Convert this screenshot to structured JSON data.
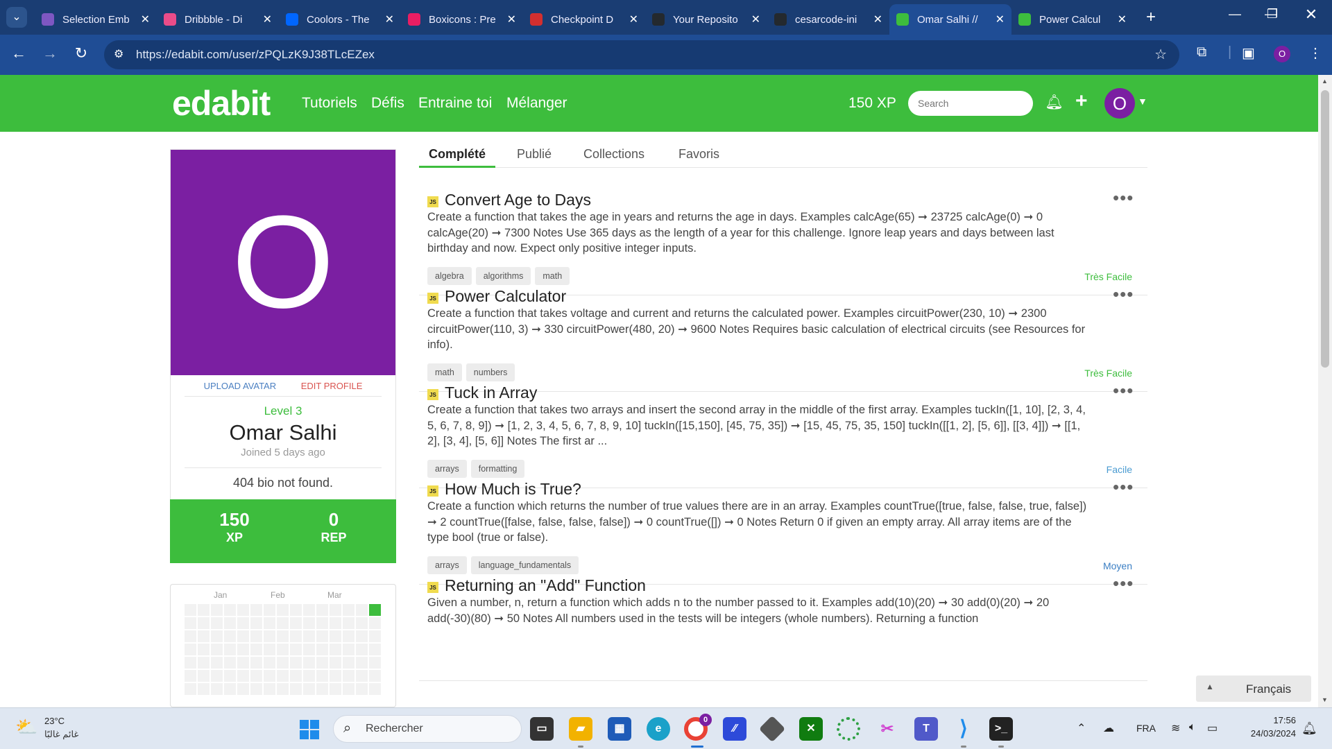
{
  "browser": {
    "tabs": [
      {
        "title": "Selection Emb",
        "favicon_color": "#7e57c2"
      },
      {
        "title": "Dribbble - Di",
        "favicon_color": "#ea4c89"
      },
      {
        "title": "Coolors - The",
        "favicon_color": "#0066ff"
      },
      {
        "title": "Boxicons : Pre",
        "favicon_color": "#e91e63"
      },
      {
        "title": "Checkpoint D",
        "favicon_color": "#d32f2f"
      },
      {
        "title": "Your Reposito",
        "favicon_color": "#24292e"
      },
      {
        "title": "cesarcode-ini",
        "favicon_color": "#24292e"
      },
      {
        "title": "Omar Salhi //",
        "favicon_color": "#3dbd3d",
        "active": true
      },
      {
        "title": "Power Calcul",
        "favicon_color": "#3dbd3d"
      }
    ],
    "url": "https://edabit.com/user/zPQLzK9J38TLcEZex",
    "profile_initial": "O"
  },
  "header": {
    "logo": "edabit",
    "nav": [
      "Tutoriels",
      "Défis",
      "Entraine toi",
      "Mélanger"
    ],
    "xp": "150 XP",
    "search_placeholder": "Search",
    "avatar_initial": "O"
  },
  "profile": {
    "avatar_initial": "O",
    "upload_avatar": "UPLOAD AVATAR",
    "edit_profile": "EDIT PROFILE",
    "level": "Level 3",
    "name": "Omar Salhi",
    "joined": "Joined 5 days ago",
    "bio": "404 bio not found.",
    "xp_value": "150",
    "xp_label": "XP",
    "rep_value": "0",
    "rep_label": "REP"
  },
  "activity": {
    "months": [
      "Jan",
      "Feb",
      "Mar"
    ],
    "active_color": "#3dbd3d"
  },
  "tabs": [
    "Complété",
    "Publié",
    "Collections",
    "Favoris"
  ],
  "challenges": [
    {
      "title": "Convert Age to Days",
      "description": "Create a function that takes the age in years and returns the age in days. Examples calcAge(65) ➞ 23725 calcAge(0) ➞ 0 calcAge(20) ➞ 7300 Notes Use 365 days as the length of a year for this challenge. Ignore leap years and days between last birthday and now. Expect only positive integer inputs.",
      "tags": [
        "algebra",
        "algorithms",
        "math"
      ],
      "difficulty": "Très Facile",
      "difficulty_color": "#3dbd3d"
    },
    {
      "title": "Power Calculator",
      "description": "Create a function that takes voltage and current and returns the calculated power. Examples circuitPower(230, 10) ➞ 2300 circuitPower(110, 3) ➞ 330 circuitPower(480, 20) ➞ 9600 Notes Requires basic calculation of electrical circuits (see Resources for info).",
      "tags": [
        "math",
        "numbers"
      ],
      "difficulty": "Très Facile",
      "difficulty_color": "#3dbd3d"
    },
    {
      "title": "Tuck in Array",
      "description": "Create a function that takes two arrays and insert the second array in the middle of the first array. Examples tuckIn([1, 10], [2, 3, 4, 5, 6, 7, 8, 9]) ➞ [1, 2, 3, 4, 5, 6, 7, 8, 9, 10] tuckIn([15,150], [45, 75, 35]) ➞ [15, 45, 75, 35, 150] tuckIn([[1, 2], [5, 6]], [[3, 4]]) ➞ [[1, 2], [3, 4], [5, 6]] Notes The first ar ...",
      "tags": [
        "arrays",
        "formatting"
      ],
      "difficulty": "Facile",
      "difficulty_color": "#4a9bd1"
    },
    {
      "title": "How Much is True?",
      "description": "Create a function which returns the number of true values there are in an array. Examples countTrue([true, false, false, true, false]) ➞ 2 countTrue([false, false, false, false]) ➞ 0 countTrue([]) ➞ 0 Notes Return 0 if given an empty array. All array items are of the type bool (true or false).",
      "tags": [
        "arrays",
        "language_fundamentals"
      ],
      "difficulty": "Moyen",
      "difficulty_color": "#3b7fc4"
    },
    {
      "title": "Returning an \"Add\" Function",
      "description": "Given a number, n, return a function which adds n to the number passed to it. Examples add(10)(20) ➞ 30 add(0)(20) ➞ 20 add(-30)(80) ➞ 50 Notes All numbers used in the tests will be integers (whole numbers). Returning a function",
      "tags": [],
      "difficulty": "",
      "difficulty_color": "#3dbd3d"
    }
  ],
  "language_button": "Français",
  "taskbar": {
    "temperature": "23°C",
    "weather_desc": "غائم غالبًا",
    "search_placeholder": "Rechercher",
    "chrome_badge": "0",
    "language": "FRA",
    "time": "17:56",
    "date": "24/03/2024"
  }
}
